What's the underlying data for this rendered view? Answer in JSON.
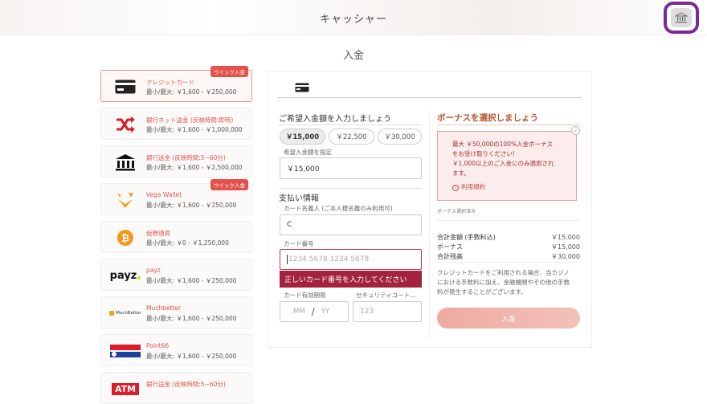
{
  "header": {
    "title": "キャッシャー"
  },
  "page": {
    "title": "入金"
  },
  "methods": [
    {
      "name": "クレジットカード",
      "range": "最小/最大: ￥1,600 - ￥250,000",
      "badge": "ウイック入金"
    },
    {
      "name": "銀行ネット送金 (反映時間:即時)",
      "range": "最小/最大: ￥1,600 - ￥1,000,000",
      "badge": ""
    },
    {
      "name": "銀行送金 (反映時間:5~60分)",
      "range": "最小/最大: ￥1,600 - ￥2,500,000",
      "badge": ""
    },
    {
      "name": "Vega Wallet",
      "range": "最小/最大: ￥1,600 - ￥250,000",
      "badge": "ウイック入金"
    },
    {
      "name": "仮想通貨",
      "range": "最小/最大: ￥0 - ￥1,250,000",
      "badge": ""
    },
    {
      "name": "payz",
      "range": "最小/最大: ￥1,600 - ￥250,000",
      "badge": "",
      "logo_text": "payz"
    },
    {
      "name": "Muchbetter",
      "range": "最小/最大: ￥1,600 - ￥250,000",
      "badge": "",
      "logo_text": "MuchBetter"
    },
    {
      "name": "Point66",
      "range": "最小/最大: ￥1,600 - ￥250,000",
      "badge": ""
    },
    {
      "name": "銀行送金 (反映時間:5~60分)",
      "range": "",
      "badge": "",
      "logo_text": "ATM"
    }
  ],
  "deposit": {
    "amount_heading": "ご希望入金額を入力しましょう",
    "amount_options": [
      "￥15,000",
      "￥22,500",
      "￥30,000"
    ],
    "amount_label": "希望入金額を指定",
    "amount_value": "￥15,000",
    "payment_heading": "支払い情報",
    "holder_label": "カード名義人 (ご本人様名義のみ利用可)",
    "holder_value": "C",
    "number_label": "カード番号",
    "number_placeholder": "1234 5678 1234 5678",
    "number_error": "正しいカード番号を入力してください",
    "expiry_label": "カード有効期限",
    "expiry_mm": "MM",
    "expiry_sep": "/",
    "expiry_yy": "YY",
    "cvc_label": "セキュリティコート…",
    "cvc_placeholder": "123"
  },
  "bonus": {
    "title": "ボーナスを選択しましょう",
    "line1": "最大 ￥50,000の100%入金ボーナス",
    "line2": "をお受け取りください!",
    "line3": "￥1,000以上のご入金にのみ適用され",
    "line4": "ます。",
    "terms": "利用規約",
    "selected_note": "ボーナス選択済み",
    "check": "✓"
  },
  "summary": {
    "rows": [
      {
        "label": "合計金額 (手数料込)",
        "value": "￥15,000"
      },
      {
        "label": "ボーナス",
        "value": "￥15,000"
      },
      {
        "label": "合計残高",
        "value": "￥30,000"
      }
    ],
    "notice_line1": "クレジットカードをご利用される場合、当カジノ",
    "notice_line2": "における手数料に加え、金融機関やその他の手数",
    "notice_line3": "料が発生することがございます。",
    "submit": "入金"
  }
}
